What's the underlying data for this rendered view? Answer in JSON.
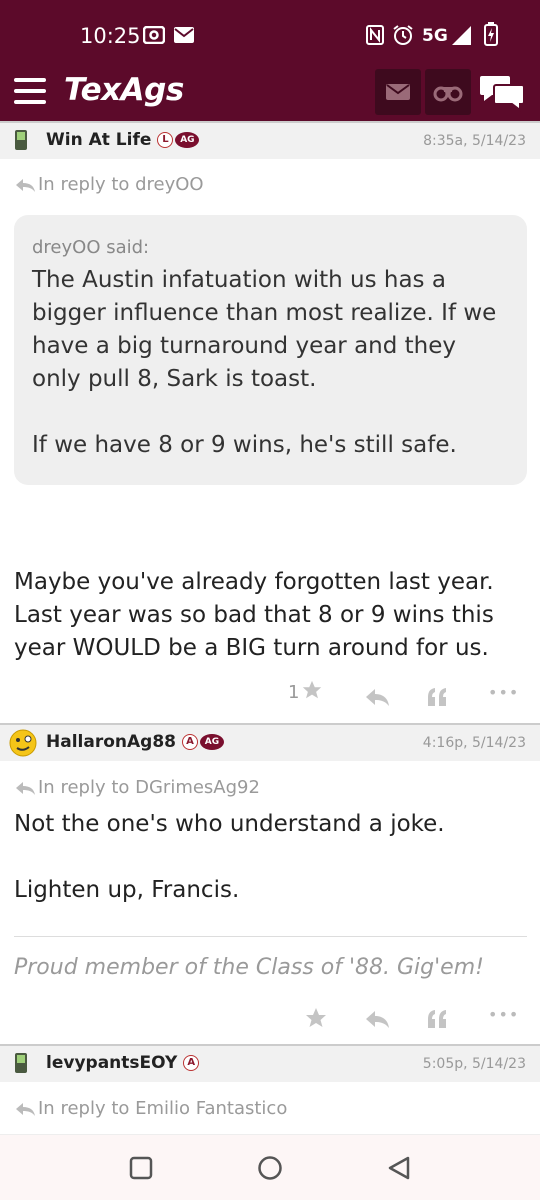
{
  "status_bar": {
    "time": "10:25",
    "network": "5G"
  },
  "app": {
    "logo": "TexAgs"
  },
  "posts": [
    {
      "username": "Win At Life",
      "badges": [
        "L",
        "AG"
      ],
      "timestamp": "8:35a, 5/14/23",
      "reply_to": "In reply to dreyOO",
      "quote": {
        "author": "dreyOO said:",
        "text": "The Austin infatuation with us has a bigger influence than most realize. If we have a big turnaround year and they only pull 8, Sark is toast.",
        "text2": "If we have 8 or 9 wins, he's still safe."
      },
      "body": "Maybe you've already forgotten last year. Last year was so bad that 8 or 9 wins this year WOULD be a BIG turn around for us.",
      "likes": "1"
    },
    {
      "username": "HallaronAg88",
      "badges": [
        "A",
        "AG"
      ],
      "timestamp": "4:16p, 5/14/23",
      "reply_to": "In reply to DGrimesAg92",
      "body": "Not the one's who understand a joke.",
      "body2": "Lighten up, Francis.",
      "signature": "Proud member of the Class of '88. Gig'em!"
    },
    {
      "username": "levypantsEOY",
      "badges": [
        "A"
      ],
      "timestamp": "5:05p, 5/14/23",
      "reply_to": "In reply to Emilio Fantastico"
    }
  ],
  "icons": {
    "more": "•••"
  }
}
